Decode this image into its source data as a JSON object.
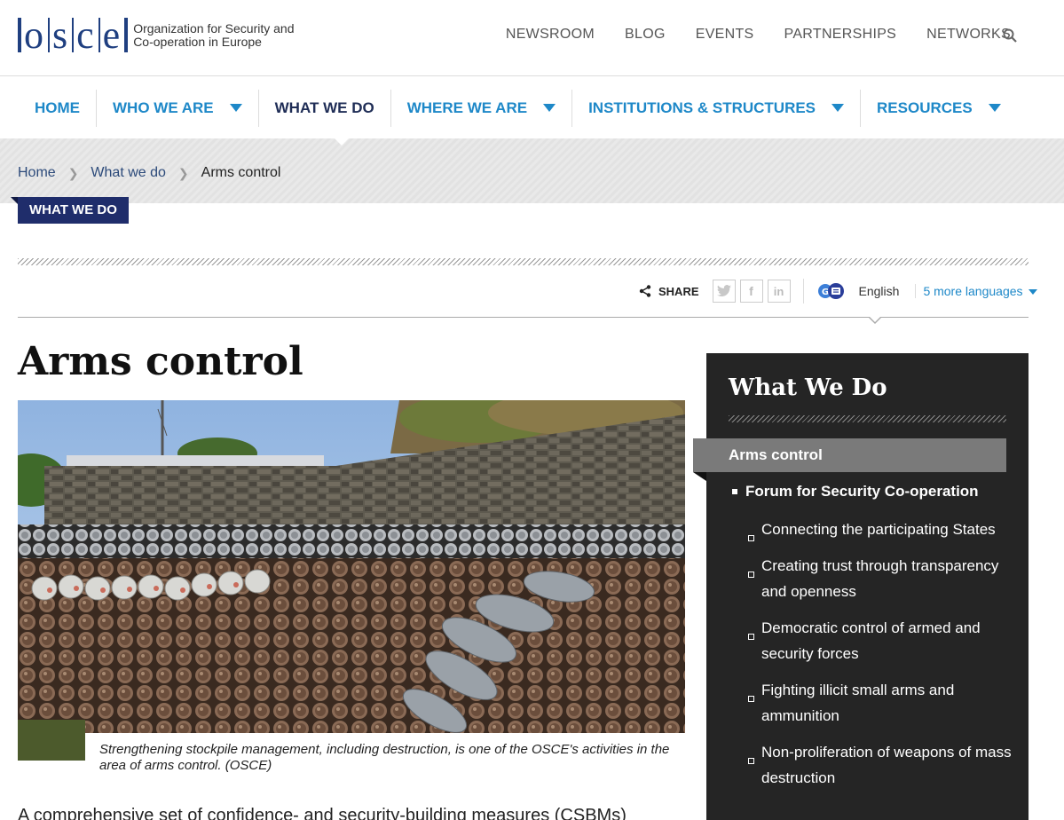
{
  "header": {
    "logo_letters": "osce",
    "logo_line1": "Organization for Security and",
    "logo_line2": "Co-operation in Europe",
    "top_links": [
      "NEWSROOM",
      "BLOG",
      "EVENTS",
      "PARTNERSHIPS",
      "NETWORKS"
    ]
  },
  "main_nav": {
    "items": [
      {
        "label": "HOME",
        "dropdown": false,
        "active": false
      },
      {
        "label": "WHO WE ARE",
        "dropdown": true,
        "active": false
      },
      {
        "label": "WHAT WE DO",
        "dropdown": false,
        "active": true
      },
      {
        "label": "WHERE WE ARE",
        "dropdown": true,
        "active": false
      },
      {
        "label": "INSTITUTIONS & STRUCTURES",
        "dropdown": true,
        "active": false
      },
      {
        "label": "RESOURCES",
        "dropdown": true,
        "active": false
      }
    ]
  },
  "breadcrumb": [
    "Home",
    "What we do",
    "Arms control"
  ],
  "section_tag": "WHAT WE DO",
  "share": {
    "label": "SHARE",
    "language_current": "English",
    "language_more": "5 more languages"
  },
  "page": {
    "title": "Arms control",
    "caption": "Strengthening stockpile management, including destruction, is one of the OSCE's activities in the area of arms control. (OSCE)",
    "body_start": "A comprehensive set of confidence- and security-building measures (CSBMs)"
  },
  "sidebar": {
    "title": "What We Do",
    "active": "Arms control",
    "subsection": "Forum for Security Co-operation",
    "items": [
      "Connecting the participating States",
      "Creating trust through transparency and openness",
      "Democratic control of armed and security forces",
      "Fighting illicit small arms and ammunition",
      "Non-proliferation of weapons of mass destruction"
    ]
  },
  "colors": {
    "brand_blue": "#1f3f80",
    "nav_blue": "#1e88c8",
    "tag_navy": "#1f2d6b",
    "sidebar_bg": "#252525"
  }
}
